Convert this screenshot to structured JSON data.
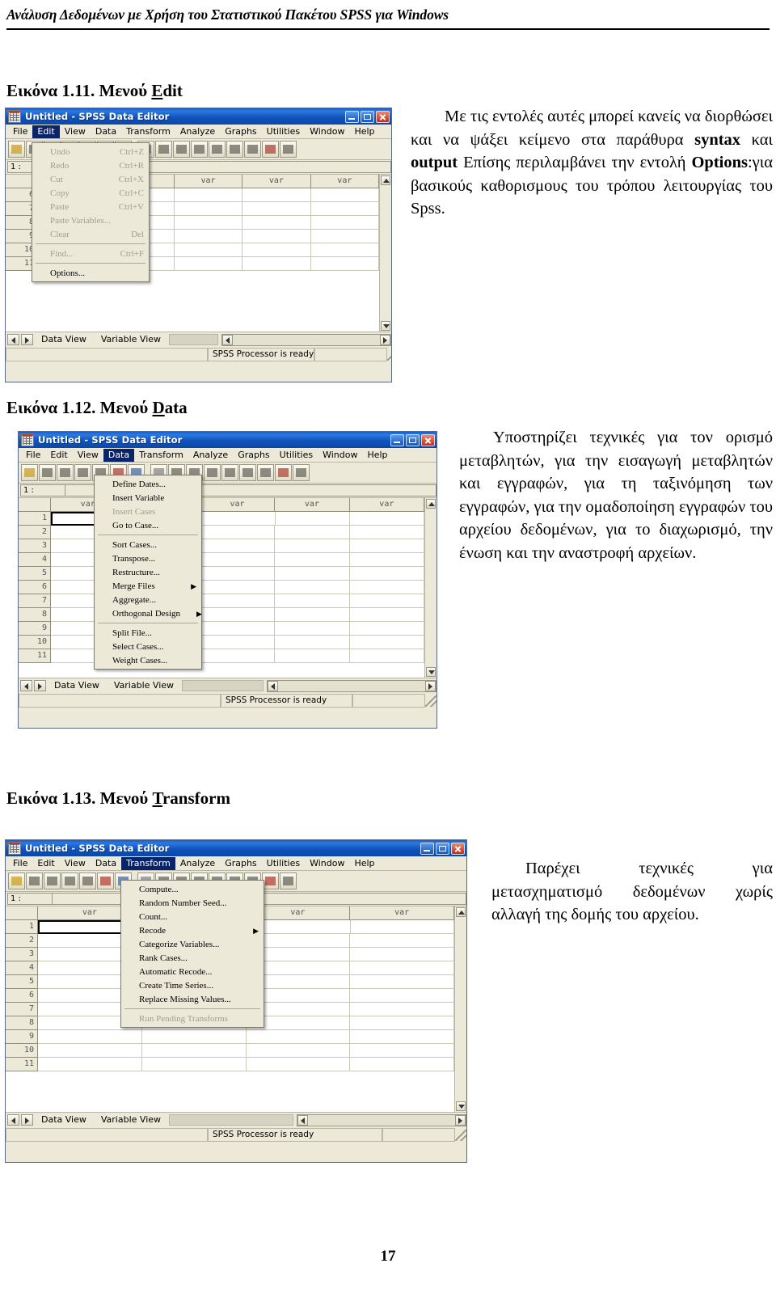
{
  "header": {
    "running_title": "Ανάλυση Δεδομένων με Χρήση του Στατιστικού Πακέτου SPSS  για Windows"
  },
  "page_number": "17",
  "figures": [
    {
      "caption_prefix": "Εικόνα 1.11. Μενού ",
      "caption_menu": "E",
      "caption_rest": "dit",
      "window": {
        "title": "Untitled - SPSS Data Editor",
        "menubar": [
          "File",
          "Edit",
          "View",
          "Data",
          "Transform",
          "Analyze",
          "Graphs",
          "Utilities",
          "Window",
          "Help"
        ],
        "active_menu": "Edit",
        "cell_ref": "1 :",
        "column_headers": [
          "var",
          "var",
          "var",
          "var",
          "var"
        ],
        "row_numbers": [
          "6",
          "7",
          "8",
          "9",
          "10",
          "11"
        ],
        "tabs": [
          "Data View",
          "Variable View"
        ],
        "selected_tab": "Data View",
        "status_text": "SPSS Processor  is ready"
      },
      "menu_items": [
        {
          "label": "Undo",
          "accel": "Ctrl+Z",
          "disabled": true
        },
        {
          "label": "Redo",
          "accel": "Ctrl+R",
          "disabled": true
        },
        {
          "label": "Cut",
          "accel": "Ctrl+X",
          "disabled": true
        },
        {
          "label": "Copy",
          "accel": "Ctrl+C",
          "disabled": true
        },
        {
          "label": "Paste",
          "accel": "Ctrl+V",
          "disabled": true
        },
        {
          "label": "Paste Variables...",
          "accel": "",
          "disabled": true
        },
        {
          "label": "Clear",
          "accel": "Del",
          "disabled": true
        },
        {
          "divider": true
        },
        {
          "label": "Find...",
          "accel": "Ctrl+F",
          "disabled": true
        },
        {
          "divider": true
        },
        {
          "label": "Options...",
          "accel": "",
          "disabled": false
        }
      ],
      "paragraph": {
        "segments": [
          {
            "text": "Με τις εντολές αυτές μπορεί  κανείς να διορθώσει και να ψάξει  κείμενο στα παράθυρα ",
            "bold": false
          },
          {
            "text": "syntax",
            "bold": true
          },
          {
            "text": " και ",
            "bold": false
          },
          {
            "text": "output",
            "bold": true
          },
          {
            "text": " Επίσης περιλαμβάνει την εντολή ",
            "bold": false
          },
          {
            "text": "Options",
            "bold": true
          },
          {
            "text": ":για βασικούς καθορισμους του τρόπου λειτουργίας του Spss.",
            "bold": false
          }
        ]
      }
    },
    {
      "caption_prefix": "Εικόνα 1.12. Μενού ",
      "caption_menu": "D",
      "caption_rest": "ata",
      "window": {
        "title": "Untitled - SPSS Data Editor",
        "menubar": [
          "File",
          "Edit",
          "View",
          "Data",
          "Transform",
          "Analyze",
          "Graphs",
          "Utilities",
          "Window",
          "Help"
        ],
        "active_menu": "Data",
        "cell_ref": "1 :",
        "column_headers": [
          "var",
          "var",
          "var",
          "var",
          "var"
        ],
        "row_numbers": [
          "1",
          "2",
          "3",
          "4",
          "5",
          "6",
          "7",
          "8",
          "9",
          "10",
          "11"
        ],
        "tabs": [
          "Data View",
          "Variable View"
        ],
        "selected_tab": "Data View",
        "status_text": "SPSS Processor  is ready"
      },
      "menu_items": [
        {
          "label": "Define Dates...",
          "accel": "",
          "disabled": false
        },
        {
          "label": "Insert Variable",
          "accel": "",
          "disabled": false
        },
        {
          "label": "Insert Cases",
          "accel": "",
          "disabled": true
        },
        {
          "label": "Go to Case...",
          "accel": "",
          "disabled": false
        },
        {
          "divider": true
        },
        {
          "label": "Sort Cases...",
          "accel": "",
          "disabled": false
        },
        {
          "label": "Transpose...",
          "accel": "",
          "disabled": false
        },
        {
          "label": "Restructure...",
          "accel": "",
          "disabled": false
        },
        {
          "label": "Merge Files",
          "accel": "",
          "submenu": true,
          "disabled": false
        },
        {
          "label": "Aggregate...",
          "accel": "",
          "disabled": false
        },
        {
          "label": "Orthogonal Design",
          "accel": "",
          "submenu": true,
          "disabled": false
        },
        {
          "divider": true
        },
        {
          "label": "Split File...",
          "accel": "",
          "disabled": false
        },
        {
          "label": "Select Cases...",
          "accel": "",
          "disabled": false
        },
        {
          "label": "Weight Cases...",
          "accel": "",
          "disabled": false
        }
      ],
      "paragraph": {
        "segments": [
          {
            "text": "Υποστηρίζει τεχνικές για τον ορισμό μεταβλητών, για την εισαγωγή μεταβλητών και εγγραφών, για τη ταξινόμηση των εγγραφών, για την ομαδοποίηση εγγραφών του αρχείου δεδομένων, για το διαχωρισμό, την ένωση και την αναστροφή αρχείων.",
            "bold": false
          }
        ]
      }
    },
    {
      "caption_prefix": "Εικόνα 1.13. Μενού ",
      "caption_menu": "T",
      "caption_rest": "ransform",
      "window": {
        "title": "Untitled - SPSS Data Editor",
        "menubar": [
          "File",
          "Edit",
          "View",
          "Data",
          "Transform",
          "Analyze",
          "Graphs",
          "Utilities",
          "Window",
          "Help"
        ],
        "active_menu": "Transform",
        "cell_ref": "1 :",
        "column_headers": [
          "var",
          "var",
          "var",
          "var"
        ],
        "row_numbers": [
          "1",
          "2",
          "3",
          "4",
          "5",
          "6",
          "7",
          "8",
          "9",
          "10",
          "11"
        ],
        "tabs": [
          "Data View",
          "Variable View"
        ],
        "selected_tab": "Data View",
        "status_text": "SPSS Processor  is ready"
      },
      "menu_items": [
        {
          "label": "Compute...",
          "accel": "",
          "disabled": false
        },
        {
          "label": "Random Number Seed...",
          "accel": "",
          "disabled": false
        },
        {
          "label": "Count...",
          "accel": "",
          "disabled": false
        },
        {
          "label": "Recode",
          "accel": "",
          "submenu": true,
          "disabled": false
        },
        {
          "label": "Categorize Variables...",
          "accel": "",
          "disabled": false
        },
        {
          "label": "Rank Cases...",
          "accel": "",
          "disabled": false
        },
        {
          "label": "Automatic Recode...",
          "accel": "",
          "disabled": false
        },
        {
          "label": "Create Time Series...",
          "accel": "",
          "disabled": false
        },
        {
          "label": "Replace Missing Values...",
          "accel": "",
          "disabled": false
        },
        {
          "divider": true
        },
        {
          "label": "Run Pending Transforms",
          "accel": "",
          "disabled": true
        }
      ],
      "paragraph": {
        "segments": [
          {
            "text": "Παρέχει τεχνικές για μετασχηματισμό δεδομένων χωρίς αλλαγή της δομής του αρχείου.",
            "bold": false
          }
        ]
      }
    }
  ]
}
